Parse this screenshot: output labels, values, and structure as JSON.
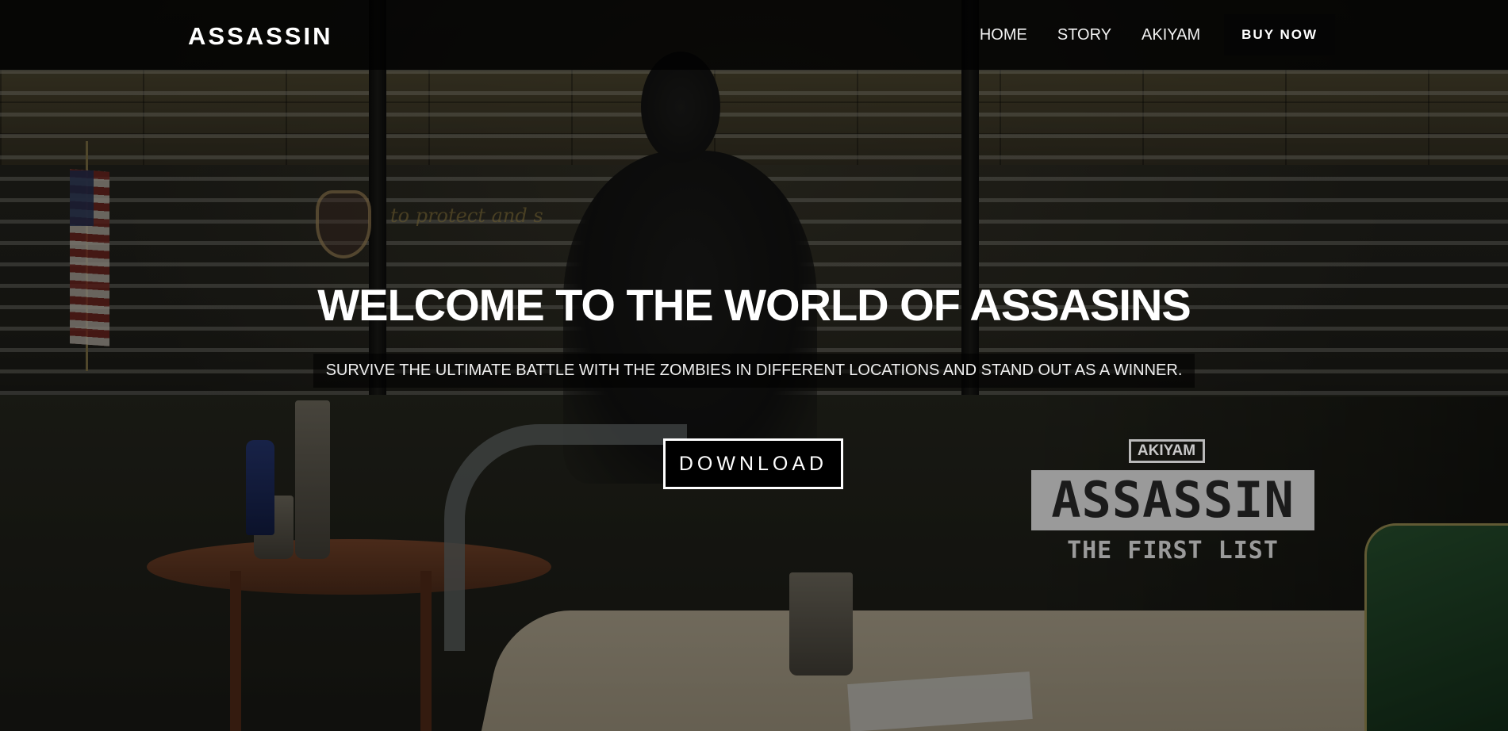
{
  "navbar": {
    "brand": "ASSASSIN",
    "links": [
      {
        "label": "HOME"
      },
      {
        "label": "STORY"
      },
      {
        "label": "AKIYAM"
      }
    ],
    "cta_label": "BUY NOW"
  },
  "hero": {
    "title": "WELCOME TO THE WORLD OF ASSASINS",
    "subtitle": "SURVIVE THE ULTIMATE BATTLE WITH THE ZOMBIES IN DIFFERENT LOCATIONS AND STAND OUT AS A WINNER.",
    "download_label": "DOWNLOAD"
  },
  "game_logo": {
    "studio": "AKIYAM",
    "title": "ASSASSIN",
    "subtitle": "THE FIRST LIST"
  },
  "background": {
    "description_icon": "office-scene-background",
    "wall_motto": "to protect and s"
  },
  "colors": {
    "navbar_bg": "#000000",
    "cta_bg": "#050505",
    "text_primary": "#ffffff",
    "logo_plate": "#9a9a9a"
  }
}
